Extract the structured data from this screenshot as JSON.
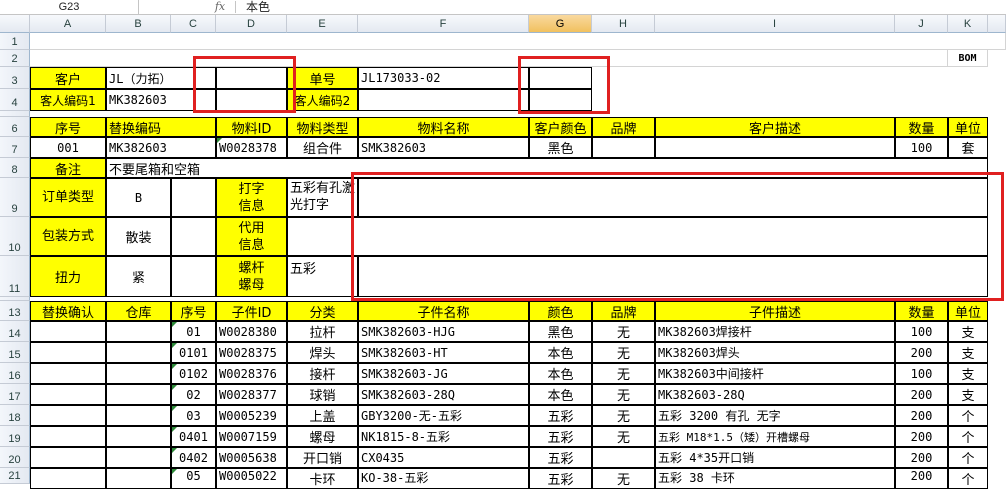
{
  "formula_bar": {
    "name_box": "G23",
    "fx": "fx",
    "content": "本色"
  },
  "columns": [
    "A",
    "B",
    "C",
    "D",
    "E",
    "F",
    "G",
    "H",
    "I",
    "J",
    "K"
  ],
  "selected_column": "G",
  "rows": [
    "1",
    "2",
    "3",
    "4",
    "6",
    "7",
    "8",
    "9",
    "10",
    "11",
    "13",
    "14",
    "15",
    "16",
    "17",
    "18",
    "19",
    "20",
    "21"
  ],
  "header": {
    "bom": "BOM",
    "customer_label": "客户",
    "customer_value": "JL（力拓）",
    "order_label": "单号",
    "order_value": "JL173033-02",
    "cust_code_label": "客人编码1",
    "cust_code_value": "MK382603",
    "cust_code2_label": "客人编码2"
  },
  "material_table": {
    "headers": [
      "序号",
      "替换编码",
      "物料ID",
      "物料类型",
      "物料名称",
      "客户颜色",
      "品牌",
      "客户描述",
      "数量",
      "单位"
    ],
    "row": [
      "001",
      "MK382603",
      "W0028378",
      "组合件",
      "SMK382603",
      "黑色",
      "",
      "",
      "100",
      "套"
    ]
  },
  "notes": {
    "remark_label": "备注",
    "remark_value": "不要尾箱和空箱",
    "order_type_label": "订单类型",
    "order_type_value": "B",
    "print_label": "打字信息",
    "print_value": "五彩有孔激光打字",
    "pack_label": "包装方式",
    "pack_value": "散装",
    "proxy_label": "代用信息",
    "torque_label": "扭力",
    "torque_value": "紧",
    "nut_label": "螺杆螺母",
    "nut_value": "五彩"
  },
  "parts_table": {
    "headers": [
      "替换确认",
      "仓库",
      "序号",
      "子件ID",
      "分类",
      "子件名称",
      "颜色",
      "品牌",
      "子件描述",
      "数量",
      "单位"
    ],
    "rows": [
      [
        "",
        "",
        "01",
        "W0028380",
        "拉杆",
        "SMK382603-HJG",
        "黑色",
        "无",
        "MK382603焊接杆",
        "100",
        "支"
      ],
      [
        "",
        "",
        "0101",
        "W0028375",
        "焊头",
        "SMK382603-HT",
        "本色",
        "无",
        "MK382603焊头",
        "200",
        "支"
      ],
      [
        "",
        "",
        "0102",
        "W0028376",
        "接杆",
        "SMK382603-JG",
        "本色",
        "无",
        "MK382603中间接杆",
        "100",
        "支"
      ],
      [
        "",
        "",
        "02",
        "W0028377",
        "球销",
        "SMK382603-28Q",
        "本色",
        "无",
        "MK382603-28Q",
        "200",
        "支"
      ],
      [
        "",
        "",
        "03",
        "W0005239",
        "上盖",
        "GBY3200-无-五彩",
        "五彩",
        "无",
        "五彩 3200 有孔 无字",
        "200",
        "个"
      ],
      [
        "",
        "",
        "0401",
        "W0007159",
        "螺母",
        "NK1815-8-五彩",
        "五彩",
        "无",
        "五彩 M18*1.5（矮）开槽螺母",
        "200",
        "个"
      ],
      [
        "",
        "",
        "0402",
        "W0005638",
        "开口销",
        "CX0435",
        "五彩",
        "",
        "五彩 4*35开口销",
        "200",
        "个"
      ],
      [
        "",
        "",
        "05",
        "W0005022",
        "卡环",
        "KO-38-五彩",
        "五彩",
        "无",
        "五彩 38 卡环",
        "200",
        "个"
      ]
    ]
  }
}
